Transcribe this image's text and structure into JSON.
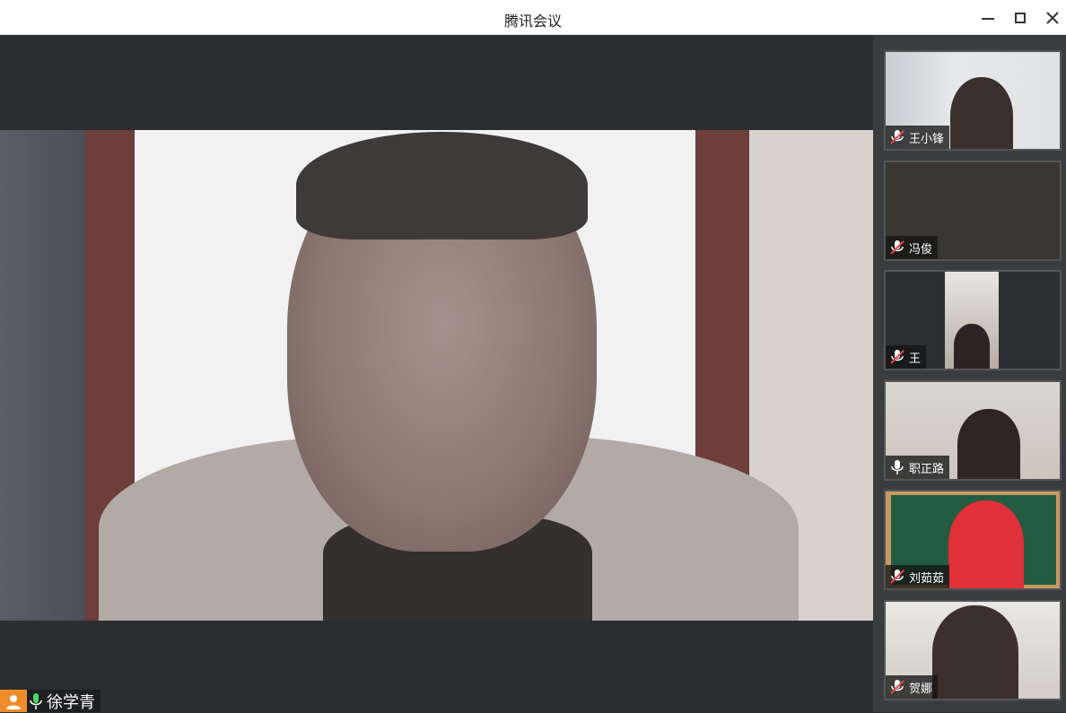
{
  "window": {
    "title": "腾讯会议",
    "controls": {
      "minimize": "minimize-icon",
      "maximize": "maximize-icon",
      "close": "close-icon"
    }
  },
  "main_speaker": {
    "name": "徐学青",
    "mic": "on",
    "avatar_icon": "person-icon"
  },
  "participants": [
    {
      "name": "王小锋",
      "mic": "muted"
    },
    {
      "name": "冯俊",
      "mic": "muted"
    },
    {
      "name": "王",
      "mic": "muted"
    },
    {
      "name": "职正路",
      "mic": "on"
    },
    {
      "name": "刘茹茹",
      "mic": "muted"
    },
    {
      "name": "贺娜",
      "mic": "muted"
    }
  ],
  "colors": {
    "titlebar": "#ffffff",
    "background": "#2b2e31",
    "sidebar": "#3a3d40",
    "mic_on": "#4cd964",
    "mic_muted": "#e84545",
    "avatar": "#f08d2a"
  }
}
